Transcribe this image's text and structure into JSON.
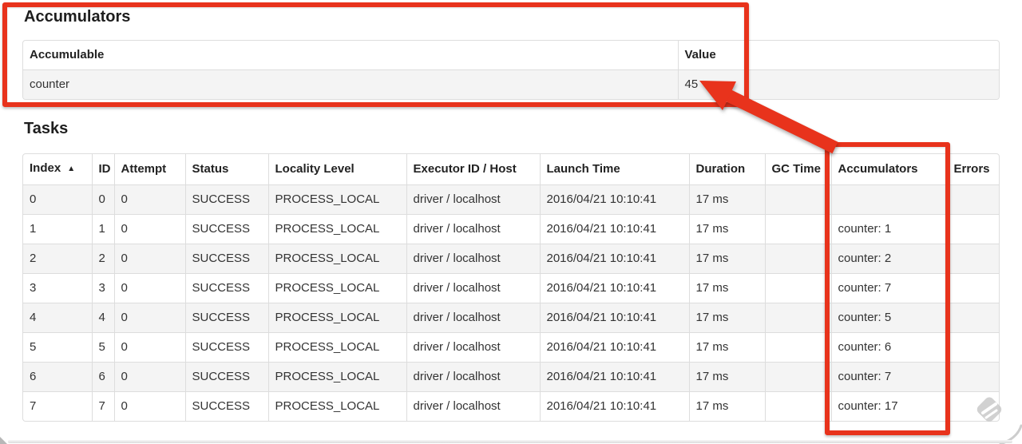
{
  "accumulators_section": {
    "heading": "Accumulators",
    "columns": [
      "Accumulable",
      "Value"
    ],
    "rows": [
      [
        "counter",
        "45"
      ]
    ]
  },
  "tasks_section": {
    "heading": "Tasks",
    "sort_icon": "▲",
    "columns": [
      "Index",
      "ID",
      "Attempt",
      "Status",
      "Locality Level",
      "Executor ID / Host",
      "Launch Time",
      "Duration",
      "GC Time",
      "Accumulators",
      "Errors"
    ],
    "rows": [
      [
        "0",
        "0",
        "0",
        "SUCCESS",
        "PROCESS_LOCAL",
        "driver / localhost",
        "2016/04/21 10:10:41",
        "17 ms",
        "",
        "",
        ""
      ],
      [
        "1",
        "1",
        "0",
        "SUCCESS",
        "PROCESS_LOCAL",
        "driver / localhost",
        "2016/04/21 10:10:41",
        "17 ms",
        "",
        "counter: 1",
        ""
      ],
      [
        "2",
        "2",
        "0",
        "SUCCESS",
        "PROCESS_LOCAL",
        "driver / localhost",
        "2016/04/21 10:10:41",
        "17 ms",
        "",
        "counter: 2",
        ""
      ],
      [
        "3",
        "3",
        "0",
        "SUCCESS",
        "PROCESS_LOCAL",
        "driver / localhost",
        "2016/04/21 10:10:41",
        "17 ms",
        "",
        "counter: 7",
        ""
      ],
      [
        "4",
        "4",
        "0",
        "SUCCESS",
        "PROCESS_LOCAL",
        "driver / localhost",
        "2016/04/21 10:10:41",
        "17 ms",
        "",
        "counter: 5",
        ""
      ],
      [
        "5",
        "5",
        "0",
        "SUCCESS",
        "PROCESS_LOCAL",
        "driver / localhost",
        "2016/04/21 10:10:41",
        "17 ms",
        "",
        "counter: 6",
        ""
      ],
      [
        "6",
        "6",
        "0",
        "SUCCESS",
        "PROCESS_LOCAL",
        "driver / localhost",
        "2016/04/21 10:10:41",
        "17 ms",
        "",
        "counter: 7",
        ""
      ],
      [
        "7",
        "7",
        "0",
        "SUCCESS",
        "PROCESS_LOCAL",
        "driver / localhost",
        "2016/04/21 10:10:41",
        "17 ms",
        "",
        "counter: 17",
        ""
      ]
    ]
  },
  "annotations": {
    "highlight_color": "#e8331c"
  }
}
